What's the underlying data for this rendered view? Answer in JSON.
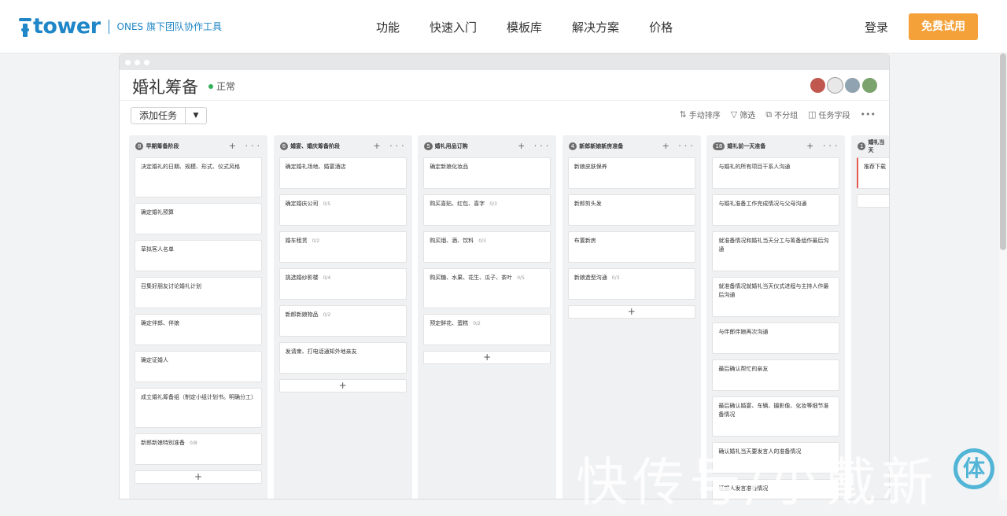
{
  "header": {
    "logo_text": "tower",
    "logo_sub": "ONES 旗下团队协作工具",
    "nav": [
      "功能",
      "快速入门",
      "模板库",
      "解决方案",
      "价格"
    ],
    "login": "登录",
    "trial": "免费试用"
  },
  "project": {
    "title": "婚礼筹备",
    "status": "正常",
    "add_task": "添加任务",
    "tools": {
      "sort": "手动排序",
      "filter": "筛选",
      "group": "不分组",
      "fields": "任务字段"
    },
    "avatar_colors": [
      "#c0584f",
      "#e8e8e8",
      "#8fa3b0",
      "#7aa36d"
    ]
  },
  "columns": [
    {
      "count": "8",
      "title": "早期筹备阶段",
      "cards": [
        {
          "text": "决定婚礼的日期、规模、形式、仪式风格",
          "sub": ""
        },
        {
          "text": "确定婚礼预算",
          "sub": ""
        },
        {
          "text": "草拟客人名单",
          "sub": ""
        },
        {
          "text": "召集好朋友讨论婚礼计划",
          "sub": ""
        },
        {
          "text": "确定伴郎、伴娘",
          "sub": ""
        },
        {
          "text": "确定证婚人",
          "sub": ""
        },
        {
          "text": "成立婚礼筹备组（制定小组计划书。明确分工）",
          "sub": ""
        },
        {
          "text": "新郎新娘特别准备",
          "sub": "0/8"
        }
      ]
    },
    {
      "count": "6",
      "title": "婚宴、婚庆筹备阶段",
      "cards": [
        {
          "text": "确定婚礼场地、婚宴酒店",
          "sub": ""
        },
        {
          "text": "确定婚庆公司",
          "sub": "0/5"
        },
        {
          "text": "婚车租赁",
          "sub": "0/2"
        },
        {
          "text": "挑选婚纱影楼",
          "sub": "0/4"
        },
        {
          "text": "新郎新娘物品",
          "sub": "0/2"
        },
        {
          "text": "发请柬、打电话通知外地亲友",
          "sub": ""
        }
      ]
    },
    {
      "count": "5",
      "title": "婚礼用品订购",
      "cards": [
        {
          "text": "确定新娘化妆品",
          "sub": ""
        },
        {
          "text": "购买喜贴、红包、喜字",
          "sub": "0/3"
        },
        {
          "text": "购买烟、酒、饮料",
          "sub": "0/3"
        },
        {
          "text": "购买糖、水果、花生、瓜子、茶叶",
          "sub": "0/5"
        },
        {
          "text": "预定鲜花、蛋糕",
          "sub": "0/2"
        }
      ]
    },
    {
      "count": "4",
      "title": "新郎新娘新房准备",
      "cards": [
        {
          "text": "新娘皮肤保养",
          "sub": ""
        },
        {
          "text": "新郎剪头发",
          "sub": ""
        },
        {
          "text": "布置新房",
          "sub": ""
        },
        {
          "text": "新娘造型沟通",
          "sub": "0/3"
        }
      ]
    },
    {
      "count": "18",
      "title": "婚礼前一天准备",
      "cards": [
        {
          "text": "与婚礼的所有项目干系人沟通",
          "sub": ""
        },
        {
          "text": "与婚礼准备工作完成情况与父母沟通",
          "sub": ""
        },
        {
          "text": "就准备情况和婚礼当天分工与筹备组作最后沟通",
          "sub": ""
        },
        {
          "text": "就准备情况就婚礼当天仪式进程与主持人作最后沟通",
          "sub": ""
        },
        {
          "text": "与伴郎伴娘再次沟通",
          "sub": ""
        },
        {
          "text": "最后确认帮忙的亲友",
          "sub": ""
        },
        {
          "text": "最后确认婚宴、车辆、摄影像、化妆等细节准备情况",
          "sub": ""
        },
        {
          "text": "确认婚礼当天要发言人的准备情况",
          "sub": ""
        },
        {
          "text": "证婚人发言准备情况",
          "sub": ""
        }
      ]
    },
    {
      "count": "1",
      "title": "婚礼当天",
      "cards": [
        {
          "text": "推荐下载",
          "sub": ""
        }
      ]
    }
  ],
  "watermark": "快传号/小戴新",
  "watermark_logo": "体"
}
